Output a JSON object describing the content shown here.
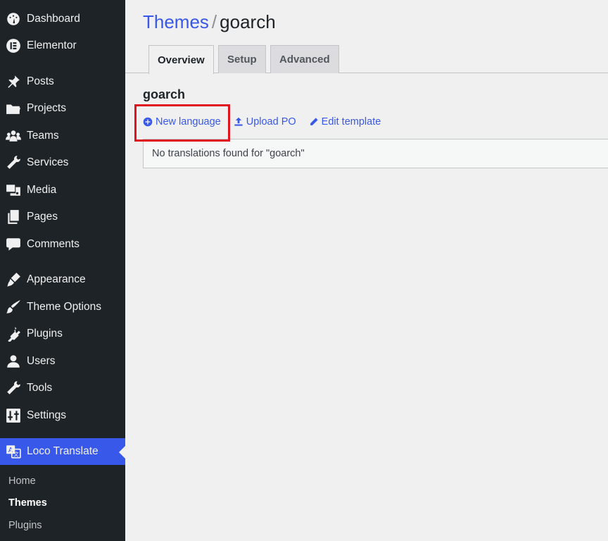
{
  "sidebar": {
    "items": [
      {
        "label": "Dashboard",
        "icon": "dashboard-icon"
      },
      {
        "label": "Elementor",
        "icon": "elementor-icon"
      },
      {
        "label": "Posts",
        "icon": "pin-icon"
      },
      {
        "label": "Projects",
        "icon": "folder-icon"
      },
      {
        "label": "Teams",
        "icon": "groups-icon"
      },
      {
        "label": "Services",
        "icon": "wrench-icon"
      },
      {
        "label": "Media",
        "icon": "media-icon"
      },
      {
        "label": "Pages",
        "icon": "pages-icon"
      },
      {
        "label": "Comments",
        "icon": "comment-icon"
      },
      {
        "label": "Appearance",
        "icon": "brush-icon"
      },
      {
        "label": "Theme Options",
        "icon": "paintbrush-icon"
      },
      {
        "label": "Plugins",
        "icon": "plug-icon"
      },
      {
        "label": "Users",
        "icon": "user-icon"
      },
      {
        "label": "Tools",
        "icon": "tools-icon"
      },
      {
        "label": "Settings",
        "icon": "settings-icon"
      },
      {
        "label": "Loco Translate",
        "icon": "translate-icon",
        "active": true
      }
    ],
    "submenu": [
      {
        "label": "Home"
      },
      {
        "label": "Themes",
        "current": true
      },
      {
        "label": "Plugins"
      }
    ]
  },
  "header": {
    "breadcrumb_link": "Themes",
    "separator": "/",
    "current": "goarch"
  },
  "tabs": [
    {
      "label": "Overview",
      "active": true
    },
    {
      "label": "Setup"
    },
    {
      "label": "Advanced"
    }
  ],
  "section": {
    "title": "goarch"
  },
  "actions": {
    "new_language": "New language",
    "upload_po": "Upload PO",
    "edit_template": "Edit template"
  },
  "notice": {
    "text": "No translations found for \"goarch\""
  },
  "colors": {
    "accent": "#3858e9",
    "sidebar": "#1d2327",
    "highlight": "#e0141e"
  }
}
